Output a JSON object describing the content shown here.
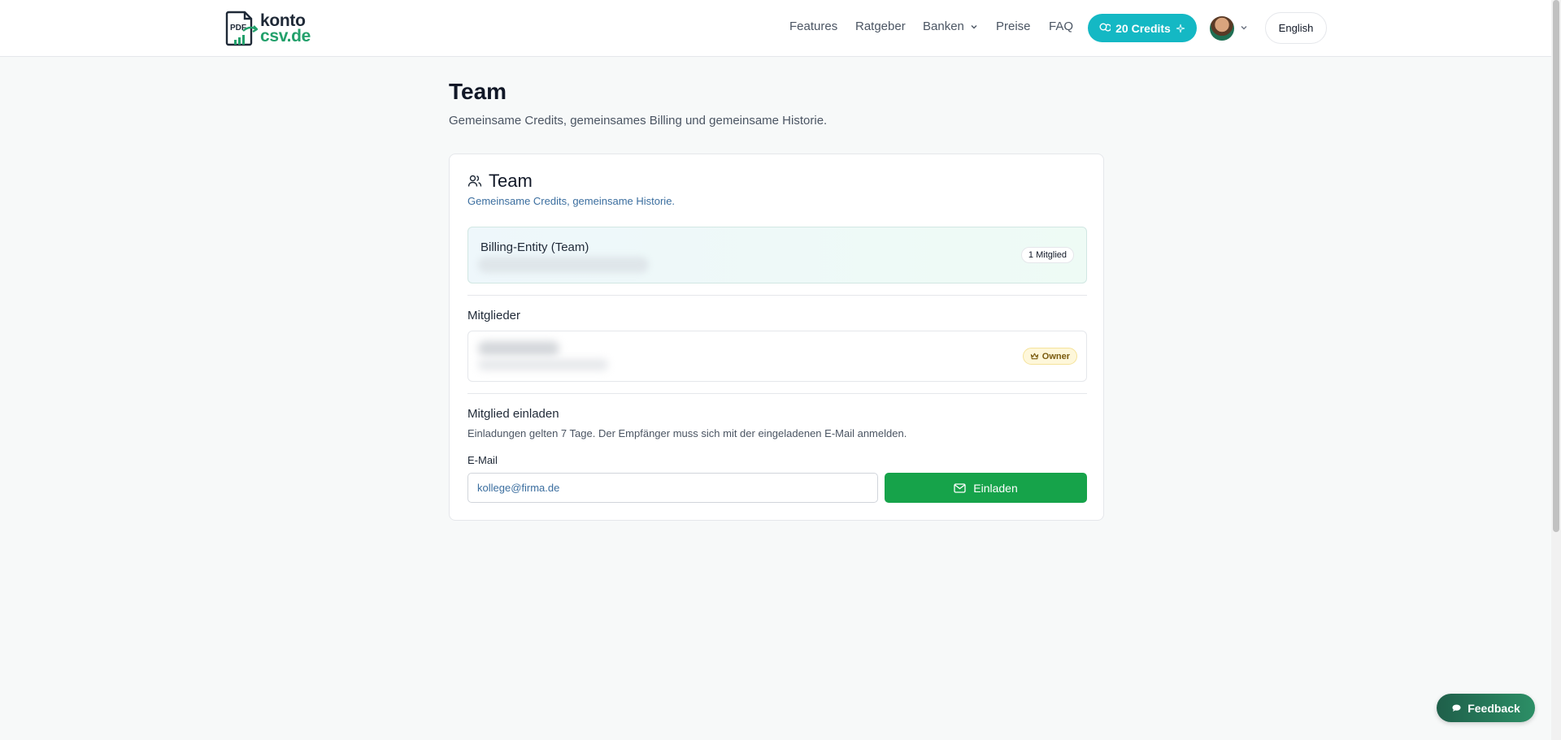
{
  "logo": {
    "line1": "konto",
    "line2": "csv.de",
    "mark_text": "PDF"
  },
  "nav": {
    "items": [
      "Features",
      "Ratgeber",
      "Banken",
      "Preise",
      "FAQ"
    ],
    "credits_label": "20 Credits",
    "language": "English"
  },
  "page": {
    "title": "Team",
    "subtitle": "Gemeinsame Credits, gemeinsames Billing und gemeinsame Historie."
  },
  "card": {
    "title": "Team",
    "subtitle": "Gemeinsame Credits, gemeinsame Historie.",
    "billing": {
      "label": "Billing-Entity (Team)",
      "members_badge": "1 Mitglied"
    },
    "members": {
      "heading": "Mitglieder",
      "owner_badge": "Owner"
    },
    "invite": {
      "heading": "Mitglied einladen",
      "description": "Einladungen gelten 7 Tage. Der Empfänger muss sich mit der eingeladenen E-Mail anmelden.",
      "email_label": "E-Mail",
      "email_placeholder": "kollege@firma.de",
      "button_label": "Einladen"
    }
  },
  "feedback_label": "Feedback",
  "colors": {
    "accent_green": "#16a34a",
    "credits_teal": "#14b8c4",
    "brand_green": "#22a06b",
    "link_blue": "#3b6e9f"
  },
  "icons": {
    "team": "users-icon",
    "credits": "coins-icon",
    "owner": "crown-icon",
    "invite": "mail-icon",
    "feedback": "chat-bubble-icon"
  }
}
